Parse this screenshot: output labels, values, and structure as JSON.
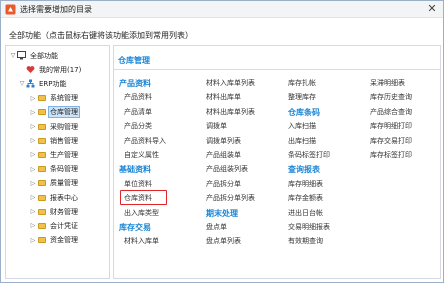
{
  "window": {
    "title": "选择需要增加的目录",
    "close_glyph": "✕"
  },
  "instruction": "全部功能（点击鼠标右键将该功能添加到常用列表）",
  "tree": [
    {
      "label": "全部功能",
      "toggle": "▽",
      "icon": "monitor-icon"
    },
    {
      "label": "我的常用(17)",
      "toggle": "",
      "icon": "heart-icon"
    },
    {
      "label": "ERP功能",
      "toggle": "▽",
      "icon": "network-icon"
    },
    {
      "label": "系统管理",
      "toggle": "▷",
      "icon": "folder-icon"
    },
    {
      "label": "仓库管理",
      "toggle": "▷",
      "icon": "folder-icon",
      "selected": true
    },
    {
      "label": "采购管理",
      "toggle": "▷",
      "icon": "folder-icon"
    },
    {
      "label": "销售管理",
      "toggle": "▷",
      "icon": "folder-icon"
    },
    {
      "label": "生产管理",
      "toggle": "▷",
      "icon": "folder-icon"
    },
    {
      "label": "条码管理",
      "toggle": "▷",
      "icon": "folder-icon"
    },
    {
      "label": "质量管理",
      "toggle": "▷",
      "icon": "folder-icon"
    },
    {
      "label": "报表中心",
      "toggle": "▷",
      "icon": "folder-icon"
    },
    {
      "label": "财务管理",
      "toggle": "▷",
      "icon": "folder-icon"
    },
    {
      "label": "会计凭证",
      "toggle": "▷",
      "icon": "folder-icon"
    },
    {
      "label": "资金管理",
      "toggle": "▷",
      "icon": "folder-icon"
    }
  ],
  "panel": {
    "header": "仓库管理",
    "columns": [
      [
        {
          "type": "cat",
          "text": "产品资料"
        },
        {
          "type": "item",
          "text": "产品资料"
        },
        {
          "type": "item",
          "text": "产品清单"
        },
        {
          "type": "item",
          "text": "产品分类"
        },
        {
          "type": "item",
          "text": "产品资料导入"
        },
        {
          "type": "item",
          "text": "自定义属性"
        },
        {
          "type": "cat",
          "text": "基础资料"
        },
        {
          "type": "item",
          "text": "单位资料"
        },
        {
          "type": "item",
          "text": "仓库资料",
          "highlight": true
        },
        {
          "type": "item",
          "text": "出入库类型"
        },
        {
          "type": "cat",
          "text": "库存交易"
        },
        {
          "type": "item",
          "text": "材料入库单"
        }
      ],
      [
        {
          "type": "item",
          "text": "材料入库单列表"
        },
        {
          "type": "item",
          "text": "材料出库单"
        },
        {
          "type": "item",
          "text": "材料出库单列表"
        },
        {
          "type": "item",
          "text": "调拨单"
        },
        {
          "type": "item",
          "text": "调拨单列表"
        },
        {
          "type": "item",
          "text": "产品组装单"
        },
        {
          "type": "item",
          "text": "产品组装列表"
        },
        {
          "type": "item",
          "text": "产品拆分单"
        },
        {
          "type": "item",
          "text": "产品拆分单列表"
        },
        {
          "type": "cat",
          "text": "期末处理"
        },
        {
          "type": "item",
          "text": "盘点单"
        },
        {
          "type": "item",
          "text": "盘点单列表"
        }
      ],
      [
        {
          "type": "item",
          "text": "库存扎帐"
        },
        {
          "type": "item",
          "text": "整理库存"
        },
        {
          "type": "cat",
          "text": "仓库条码"
        },
        {
          "type": "item",
          "text": "入库扫描"
        },
        {
          "type": "item",
          "text": "出库扫描"
        },
        {
          "type": "item",
          "text": "条码标签打印"
        },
        {
          "type": "cat",
          "text": "查询报表"
        },
        {
          "type": "item",
          "text": "库存明细表"
        },
        {
          "type": "item",
          "text": "库存金额表"
        },
        {
          "type": "item",
          "text": "进出日台帐"
        },
        {
          "type": "item",
          "text": "交易明细报表"
        },
        {
          "type": "item",
          "text": "有效期查询"
        }
      ],
      [
        {
          "type": "item",
          "text": "呆滞明细表"
        },
        {
          "type": "item",
          "text": "库存历史查询"
        },
        {
          "type": "item",
          "text": "产品综合查询"
        },
        {
          "type": "item",
          "text": "库存明细打印"
        },
        {
          "type": "item",
          "text": "库存交易打印"
        },
        {
          "type": "item",
          "text": "库存标签打印"
        }
      ]
    ]
  },
  "colors": {
    "accent": "#1a85d6",
    "highlight": "#e0242a"
  }
}
